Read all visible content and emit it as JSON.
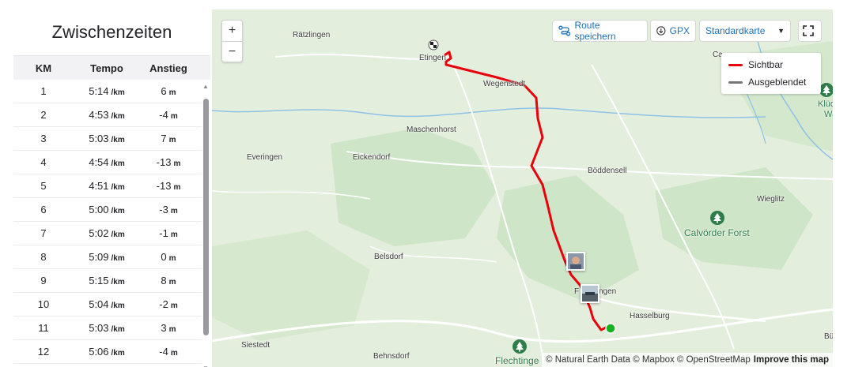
{
  "splits": {
    "title": "Zwischenzeiten",
    "columns": {
      "km": "KM",
      "pace": "Tempo",
      "elevation": "Anstieg"
    },
    "pace_unit": "/km",
    "elevation_unit": "m",
    "rows": [
      {
        "km": "1",
        "pace": "5:14",
        "elev": "6"
      },
      {
        "km": "2",
        "pace": "4:53",
        "elev": "-4"
      },
      {
        "km": "3",
        "pace": "5:03",
        "elev": "7"
      },
      {
        "km": "4",
        "pace": "4:54",
        "elev": "-13"
      },
      {
        "km": "5",
        "pace": "4:51",
        "elev": "-13"
      },
      {
        "km": "6",
        "pace": "5:00",
        "elev": "-3"
      },
      {
        "km": "7",
        "pace": "5:02",
        "elev": "-1"
      },
      {
        "km": "8",
        "pace": "5:09",
        "elev": "0"
      },
      {
        "km": "9",
        "pace": "5:15",
        "elev": "8"
      },
      {
        "km": "10",
        "pace": "5:04",
        "elev": "-2"
      },
      {
        "km": "11",
        "pace": "5:03",
        "elev": "3"
      },
      {
        "km": "12",
        "pace": "5:06",
        "elev": "-4"
      }
    ]
  },
  "map": {
    "zoom_in": "+",
    "zoom_out": "−",
    "save_route_label": "Route speichern",
    "gpx_label": "GPX",
    "map_style_label": "Standardkarte",
    "legend": {
      "visible": "Sichtbar",
      "hidden": "Ausgeblendet"
    },
    "places": {
      "raetzlingen": "Rätzlingen",
      "etingen": "Etingen",
      "wegenstedt": "Wegenstedt",
      "maschenhorst": "Maschenhorst",
      "everingen": "Everingen",
      "eickendorf": "Eickendorf",
      "boeddensell": "Böddensell",
      "wieglitz": "Wieglitz",
      "belsdorf": "Belsdorf",
      "flechtingen_partial": "F",
      "flechtingen_partial_2": "ngen",
      "hasselburg": "Hasselburg",
      "siestedt": "Siestedt",
      "behnsdorf": "Behnsdorf",
      "ca_partial": "Ca",
      "bue_partial": "Bü",
      "kluedener_partial": "Klüdener",
      "wanne_partial": "Wanne"
    },
    "forests": {
      "calvoerder": "Calvörder Forst",
      "flechtingen": "Flechtinge"
    },
    "attribution": "© Natural Earth Data © Mapbox © OpenStreetMap",
    "improve_label": "Improve this map",
    "colors": {
      "route": "#e8000b",
      "hidden_route": "#777777",
      "start": "#17b31e",
      "link": "#1f6fb4"
    }
  }
}
